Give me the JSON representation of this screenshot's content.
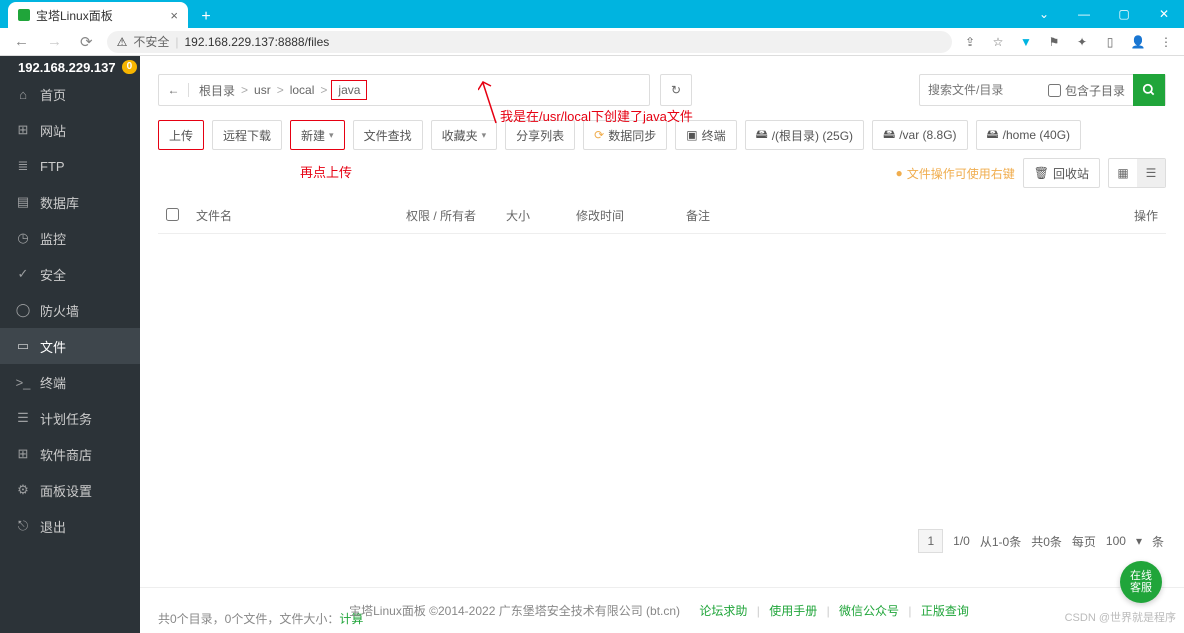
{
  "browser": {
    "tab_title": "宝塔Linux面板",
    "url_warning": "不安全",
    "url": "192.168.229.137:8888/files",
    "win": {
      "min": "—",
      "max": "▢",
      "close": "✕",
      "down": "⌄"
    }
  },
  "sidebar": {
    "ip": "192.168.229.137",
    "badge": "0",
    "items": [
      {
        "icon": "⌂",
        "label": "首页",
        "name": "home"
      },
      {
        "icon": "⊞",
        "label": "网站",
        "name": "site"
      },
      {
        "icon": "≣",
        "label": "FTP",
        "name": "ftp"
      },
      {
        "icon": "▤",
        "label": "数据库",
        "name": "db"
      },
      {
        "icon": "◷",
        "label": "监控",
        "name": "monitor"
      },
      {
        "icon": "✓",
        "label": "安全",
        "name": "security"
      },
      {
        "icon": "◯",
        "label": "防火墙",
        "name": "firewall"
      },
      {
        "icon": "▭",
        "label": "文件",
        "name": "files",
        "active": true
      },
      {
        "icon": ">_",
        "label": "终端",
        "name": "terminal"
      },
      {
        "icon": "☰",
        "label": "计划任务",
        "name": "cron"
      },
      {
        "icon": "⊞",
        "label": "软件商店",
        "name": "soft"
      },
      {
        "icon": "⚙",
        "label": "面板设置",
        "name": "settings"
      },
      {
        "icon": "⎋",
        "label": "退出",
        "name": "logout"
      }
    ]
  },
  "breadcrumb": {
    "back": "←",
    "segments": [
      "根目录",
      "usr",
      "local",
      "java"
    ],
    "refresh": "↻"
  },
  "search": {
    "placeholder": "搜索文件/目录",
    "include_sub": "包含子目录",
    "icon": "🔍"
  },
  "toolbar": {
    "upload": "上传",
    "remote": "远程下载",
    "new": "新建",
    "search": "文件查找",
    "fav": "收藏夹",
    "share": "分享列表",
    "sync": "数据同步",
    "term": "终端",
    "disks": [
      {
        "label": "/(根目录) (25G)"
      },
      {
        "label": "/var (8.8G)"
      },
      {
        "label": "/home (40G)"
      }
    ],
    "tip": "文件操作可使用右键",
    "recycle": "回收站"
  },
  "columns": {
    "name": "文件名",
    "perm": "权限 / 所有者",
    "size": "大小",
    "mtime": "修改时间",
    "note": "备注",
    "ops": "操作"
  },
  "annotations": {
    "a1": "我是在/usr/local下创建了java文件",
    "a2": "再点上传"
  },
  "status": {
    "summary_pre": "共0个目录，0个文件，文件大小：",
    "calc": "计算"
  },
  "pager": {
    "page": "1",
    "range": "1/0",
    "from_to": "从1-0条",
    "total": "共0条",
    "per_page_label": "每页",
    "per_page": "100",
    "unit": "条"
  },
  "footer": {
    "copyright": "宝塔Linux面板 ©2014-2022 广东堡塔安全技术有限公司 (bt.cn)",
    "links": [
      "论坛求助",
      "使用手册",
      "微信公众号",
      "正版查询"
    ]
  },
  "float_help": "在线\n客服",
  "watermark": "CSDN @世界就是程序"
}
